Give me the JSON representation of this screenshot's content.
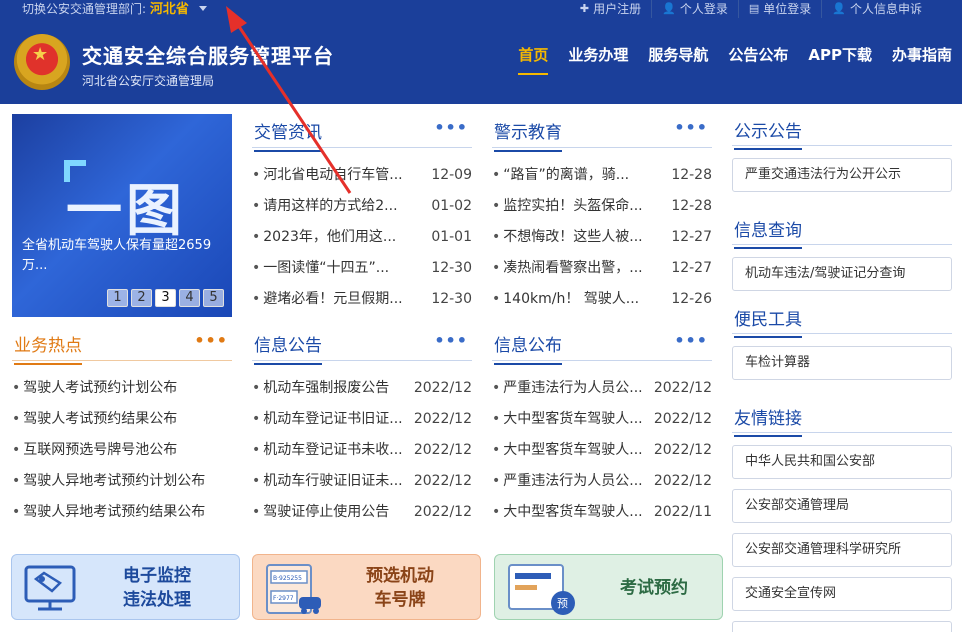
{
  "topbar": {
    "dept_label": "切换公安交通管理部门:",
    "province": "河北省",
    "links": [
      {
        "icon": "plus-icon",
        "glyph": "✚",
        "label": "用户注册"
      },
      {
        "icon": "user-icon",
        "glyph": "👤",
        "label": "个人登录"
      },
      {
        "icon": "document-icon",
        "glyph": "▤",
        "label": "单位登录"
      },
      {
        "icon": "user-icon",
        "glyph": "👤",
        "label": "个人信息申诉"
      }
    ]
  },
  "header": {
    "title": "交通安全综合服务管理平台",
    "subtitle": "河北省公安厅交通管理局",
    "nav": [
      {
        "label": "首页",
        "active": true
      },
      {
        "label": "业务办理"
      },
      {
        "label": "服务导航"
      },
      {
        "label": "公告公布"
      },
      {
        "label": "APP下载"
      },
      {
        "label": "办事指南"
      }
    ]
  },
  "slider": {
    "banner_text": "一图",
    "caption": "全省机动车驾驶人保有量超2659万...",
    "pages": [
      "1",
      "2",
      "3",
      "4",
      "5"
    ],
    "active_page": "3"
  },
  "jiaoguan": {
    "title": "交管资讯",
    "more": "•••",
    "items": [
      {
        "text": "河北省电动自行车管...",
        "date": "12-09"
      },
      {
        "text": "请用这样的方式给2...",
        "date": "01-02"
      },
      {
        "text": "2023年，他们用这...",
        "date": "01-01"
      },
      {
        "text": "一图读懂“十四五”...",
        "date": "12-30"
      },
      {
        "text": "避堵必看！元旦假期...",
        "date": "12-30"
      }
    ]
  },
  "jingshi": {
    "title": "警示教育",
    "more": "•••",
    "items": [
      {
        "text": "“路盲”的离谱，骑...",
        "date": "12-28"
      },
      {
        "text": "监控实拍！头盔保命...",
        "date": "12-28"
      },
      {
        "text": "不想悔改！这些人被...",
        "date": "12-27"
      },
      {
        "text": "凑热闹看警察出警，...",
        "date": "12-27"
      },
      {
        "text": "140km/h！ 驾驶人...",
        "date": "12-26"
      }
    ]
  },
  "yewu": {
    "title": "业务热点",
    "more": "•••",
    "items": [
      {
        "text": "驾驶人考试预约计划公布"
      },
      {
        "text": "驾驶人考试预约结果公布"
      },
      {
        "text": "互联网预选号牌号池公布"
      },
      {
        "text": "驾驶人异地考试预约计划公布"
      },
      {
        "text": "驾驶人异地考试预约结果公布"
      }
    ]
  },
  "xinxi_gonggao": {
    "title": "信息公告",
    "more": "•••",
    "items": [
      {
        "text": "机动车强制报废公告",
        "date": "2022/12"
      },
      {
        "text": "机动车登记证书旧证...",
        "date": "2022/12"
      },
      {
        "text": "机动车登记证书未收...",
        "date": "2022/12"
      },
      {
        "text": "机动车行驶证旧证未...",
        "date": "2022/12"
      },
      {
        "text": "驾驶证停止使用公告",
        "date": "2022/12"
      }
    ]
  },
  "xinxi_gongbu": {
    "title": "信息公布",
    "more": "•••",
    "items": [
      {
        "text": "严重违法行为人员公...",
        "date": "2022/12"
      },
      {
        "text": "大中型客货车驾驶人...",
        "date": "2022/12"
      },
      {
        "text": "大中型客货车驾驶人...",
        "date": "2022/12"
      },
      {
        "text": "严重违法行为人员公...",
        "date": "2022/12"
      },
      {
        "text": "大中型客货车驾驶人...",
        "date": "2022/11"
      }
    ]
  },
  "right": {
    "gongshi_title": "公示公告",
    "gongshi_item": "严重交通违法行为公开公示",
    "chaxun_title": "信息查询",
    "chaxun_item": "机动车违法/驾驶证记分查询",
    "gongju_title": "便民工具",
    "gongju_item": "车检计算器",
    "links_title": "友情链接",
    "links": [
      "中华人民共和国公安部",
      "公安部交通管理局",
      "公安部交通管理科学研究所",
      "交通安全宣传网"
    ]
  },
  "cards": {
    "monitor_line1": "电子监控",
    "monitor_line2": "违法处理",
    "plate_line1": "预选机动",
    "plate_line2": "车号牌",
    "plate_sample1": "B·925255",
    "plate_sample2": "F·2977",
    "exam": "考试预约",
    "exam_badge": "预"
  },
  "colors": {
    "brand": "#1b3f9a",
    "accent": "#f5b800",
    "link_blue": "#1b4aa7",
    "orange": "#e07a14",
    "annotation": "#e5302a"
  }
}
